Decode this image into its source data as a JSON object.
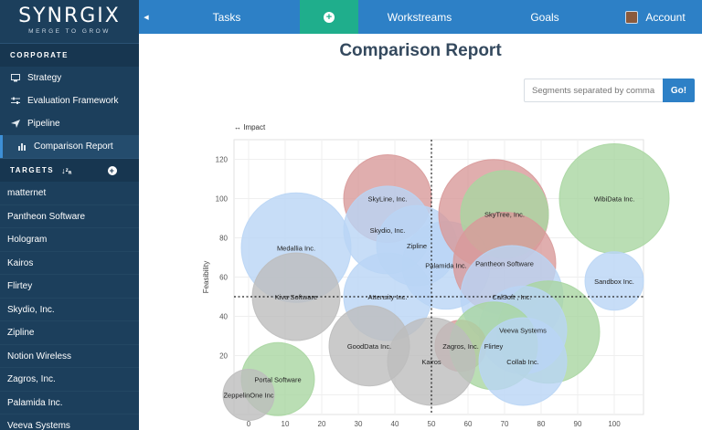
{
  "brand": {
    "name": "SYNRGIX",
    "tagline": "MERGE TO GROW"
  },
  "sidebar": {
    "section_label": "CORPORATE",
    "items": [
      {
        "label": "Strategy",
        "icon": "monitor-icon"
      },
      {
        "label": "Evaluation Framework",
        "icon": "sliders-icon"
      },
      {
        "label": "Pipeline",
        "icon": "send-icon"
      },
      {
        "label": "Comparison Report",
        "icon": "bar-chart-icon",
        "active": true
      }
    ],
    "targets_label": "TARGETS",
    "sort_glyph": "↓ᶻₐ",
    "add_glyph": "+",
    "targets": [
      "matternet",
      "Pantheon Software",
      "Hologram",
      "Kairos",
      "Flirtey",
      "Skydio, Inc.",
      "Zipline",
      "Notion Wireless",
      "Zagros, Inc.",
      "Palamida Inc.",
      "Veeva Systems"
    ]
  },
  "topbar": {
    "collapse_glyph": "◀",
    "tasks": "Tasks",
    "add_glyph": "+",
    "workstreams": "Workstreams",
    "goals": "Goals",
    "account": "Account"
  },
  "page_title": "Comparison Report",
  "search": {
    "placeholder": "Segments separated by comma",
    "button": "Go!"
  },
  "chart_data": {
    "type": "scatter",
    "legend_label": "↔ Impact",
    "ylabel": "Feasibility",
    "xlim": [
      -4,
      108
    ],
    "ylim": [
      -10,
      130
    ],
    "xticks": [
      0,
      10,
      20,
      30,
      40,
      50,
      60,
      70,
      80,
      90,
      100
    ],
    "yticks": [
      0,
      20,
      40,
      60,
      80,
      100,
      120
    ],
    "grid": true,
    "reference_lines": {
      "x": 50,
      "y": 50
    },
    "colors": {
      "blue": "#b9d5f5",
      "red": "#d89a9a",
      "green": "#a9d6a1",
      "gray": "#bdbdbd"
    },
    "points": [
      {
        "label": "SkyLine, Inc.",
        "x": 38,
        "y": 100,
        "r": 12,
        "color": "red"
      },
      {
        "label": "Skydio, Inc.",
        "x": 38,
        "y": 84,
        "r": 12,
        "color": "blue"
      },
      {
        "label": "Medallia Inc.",
        "x": 13,
        "y": 75,
        "r": 15,
        "color": "blue"
      },
      {
        "label": "Zipline",
        "x": 46,
        "y": 76,
        "r": 11,
        "color": "blue"
      },
      {
        "label": "Palamida Inc.",
        "x": 54,
        "y": 66,
        "r": 12,
        "color": "blue"
      },
      {
        "label": "",
        "x": 67,
        "y": 92,
        "r": 15,
        "color": "red"
      },
      {
        "label": "SkyTree, Inc.",
        "x": 70,
        "y": 92,
        "r": 12,
        "color": "green"
      },
      {
        "label": "WibiData Inc.",
        "x": 100,
        "y": 100,
        "r": 15,
        "color": "green"
      },
      {
        "label": "Pantheon Software",
        "x": 70,
        "y": 67,
        "r": 14,
        "color": "red"
      },
      {
        "label": "Sandbox Inc.",
        "x": 100,
        "y": 58,
        "r": 8,
        "color": "blue"
      },
      {
        "label": "Kiva Software",
        "x": 13,
        "y": 50,
        "r": 12,
        "color": "gray"
      },
      {
        "label": "Attensity Inc.",
        "x": 38,
        "y": 50,
        "r": 12,
        "color": "blue"
      },
      {
        "label": "CalSoft , Inc.",
        "x": 72,
        "y": 50,
        "r": 14,
        "color": "blue"
      },
      {
        "label": "",
        "x": 82,
        "y": 32,
        "r": 14,
        "color": "green"
      },
      {
        "label": "Veeva Systems",
        "x": 75,
        "y": 33,
        "r": 12,
        "color": "blue"
      },
      {
        "label": "GoodData Inc.",
        "x": 33,
        "y": 25,
        "r": 11,
        "color": "gray"
      },
      {
        "label": "Zagros, Inc.",
        "x": 58,
        "y": 25,
        "r": 7,
        "color": "red"
      },
      {
        "label": "Flirtey",
        "x": 67,
        "y": 25,
        "r": 12,
        "color": "green"
      },
      {
        "label": "Kairos",
        "x": 50,
        "y": 17,
        "r": 12,
        "color": "gray"
      },
      {
        "label": "Collab Inc.",
        "x": 75,
        "y": 17,
        "r": 12,
        "color": "blue"
      },
      {
        "label": "Portal Software",
        "x": 8,
        "y": 8,
        "r": 10,
        "color": "green"
      },
      {
        "label": "ZeppelinOne Inc",
        "x": 0,
        "y": 0,
        "r": 7,
        "color": "gray"
      }
    ]
  }
}
